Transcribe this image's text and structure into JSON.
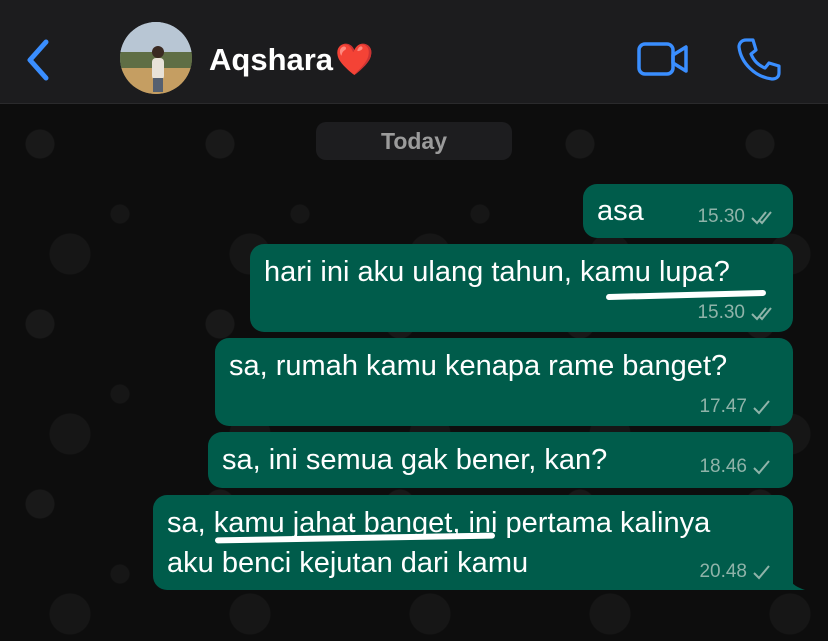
{
  "header": {
    "contact_name": "Aqshara",
    "heart": "❤️",
    "accent_color": "#3a8eff"
  },
  "chat": {
    "date_label": "Today",
    "messages": [
      {
        "text": "asa",
        "time": "15.30",
        "status": "read"
      },
      {
        "text": "hari ini aku ulang tahun, kamu lupa?",
        "time": "15.30",
        "status": "read"
      },
      {
        "text": "sa, rumah kamu kenapa rame banget?",
        "time": "17.47",
        "status": "sent"
      },
      {
        "text": "sa, ini semua gak bener, kan?",
        "time": "18.46",
        "status": "sent"
      },
      {
        "text_line1": "sa, kamu jahat banget, ini pertama kalinya",
        "text_line2": "aku benci kejutan dari kamu",
        "time": "20.48",
        "status": "sent"
      }
    ],
    "bubble_color": "#005c4b"
  }
}
